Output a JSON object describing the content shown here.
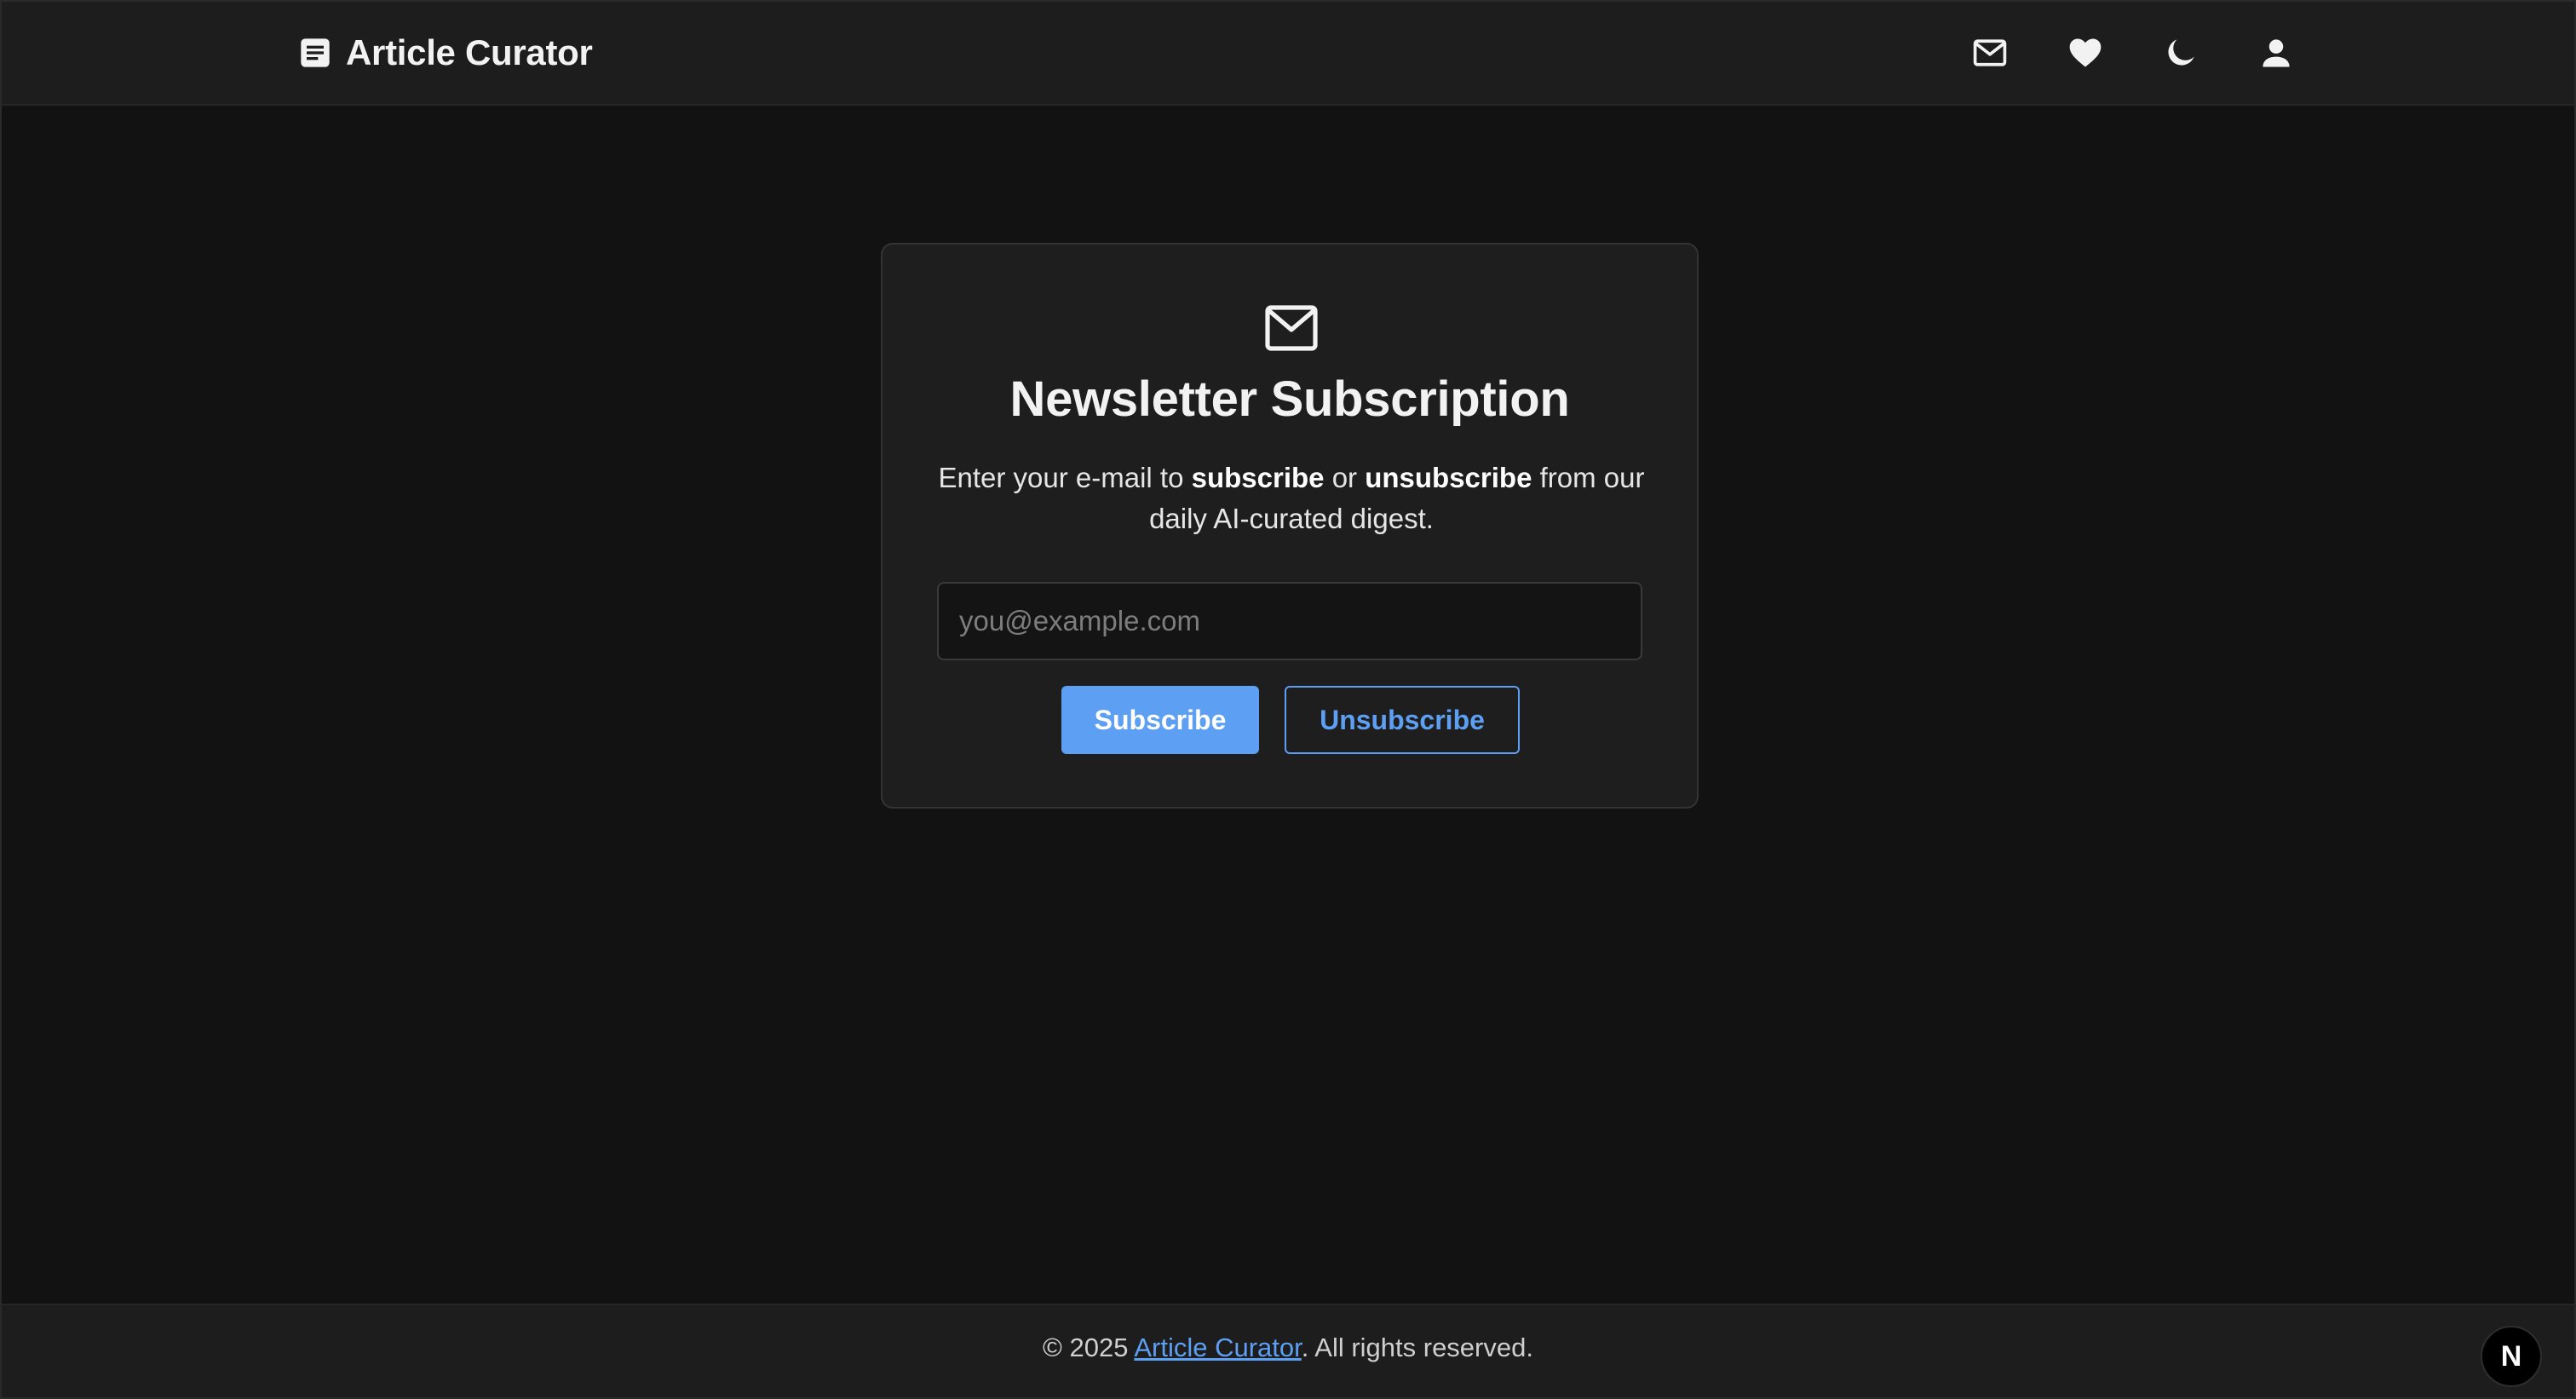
{
  "header": {
    "title": "Article Curator",
    "icons": [
      "document-icon",
      "mail-icon",
      "heart-icon",
      "moon-icon",
      "user-icon"
    ]
  },
  "card": {
    "icon": "mail-icon",
    "title": "Newsletter Subscription",
    "description": {
      "part1": "Enter your e-mail to ",
      "subscribe_word": "subscribe",
      "part2": " or ",
      "unsubscribe_word": "unsubscribe",
      "part3": " from our daily AI-curated digest."
    },
    "email_placeholder": "you@example.com",
    "email_value": "",
    "subscribe_label": "Subscribe",
    "unsubscribe_label": "Unsubscribe"
  },
  "footer": {
    "prefix": "© 2025 ",
    "link_text": "Article Curator",
    "suffix": ". All rights reserved.",
    "badge": "N"
  },
  "colors": {
    "background": "#121212",
    "header": "#1d1d1d",
    "card": "#1e1e1e",
    "accent": "#5d9ff2",
    "text": "#ececec"
  }
}
